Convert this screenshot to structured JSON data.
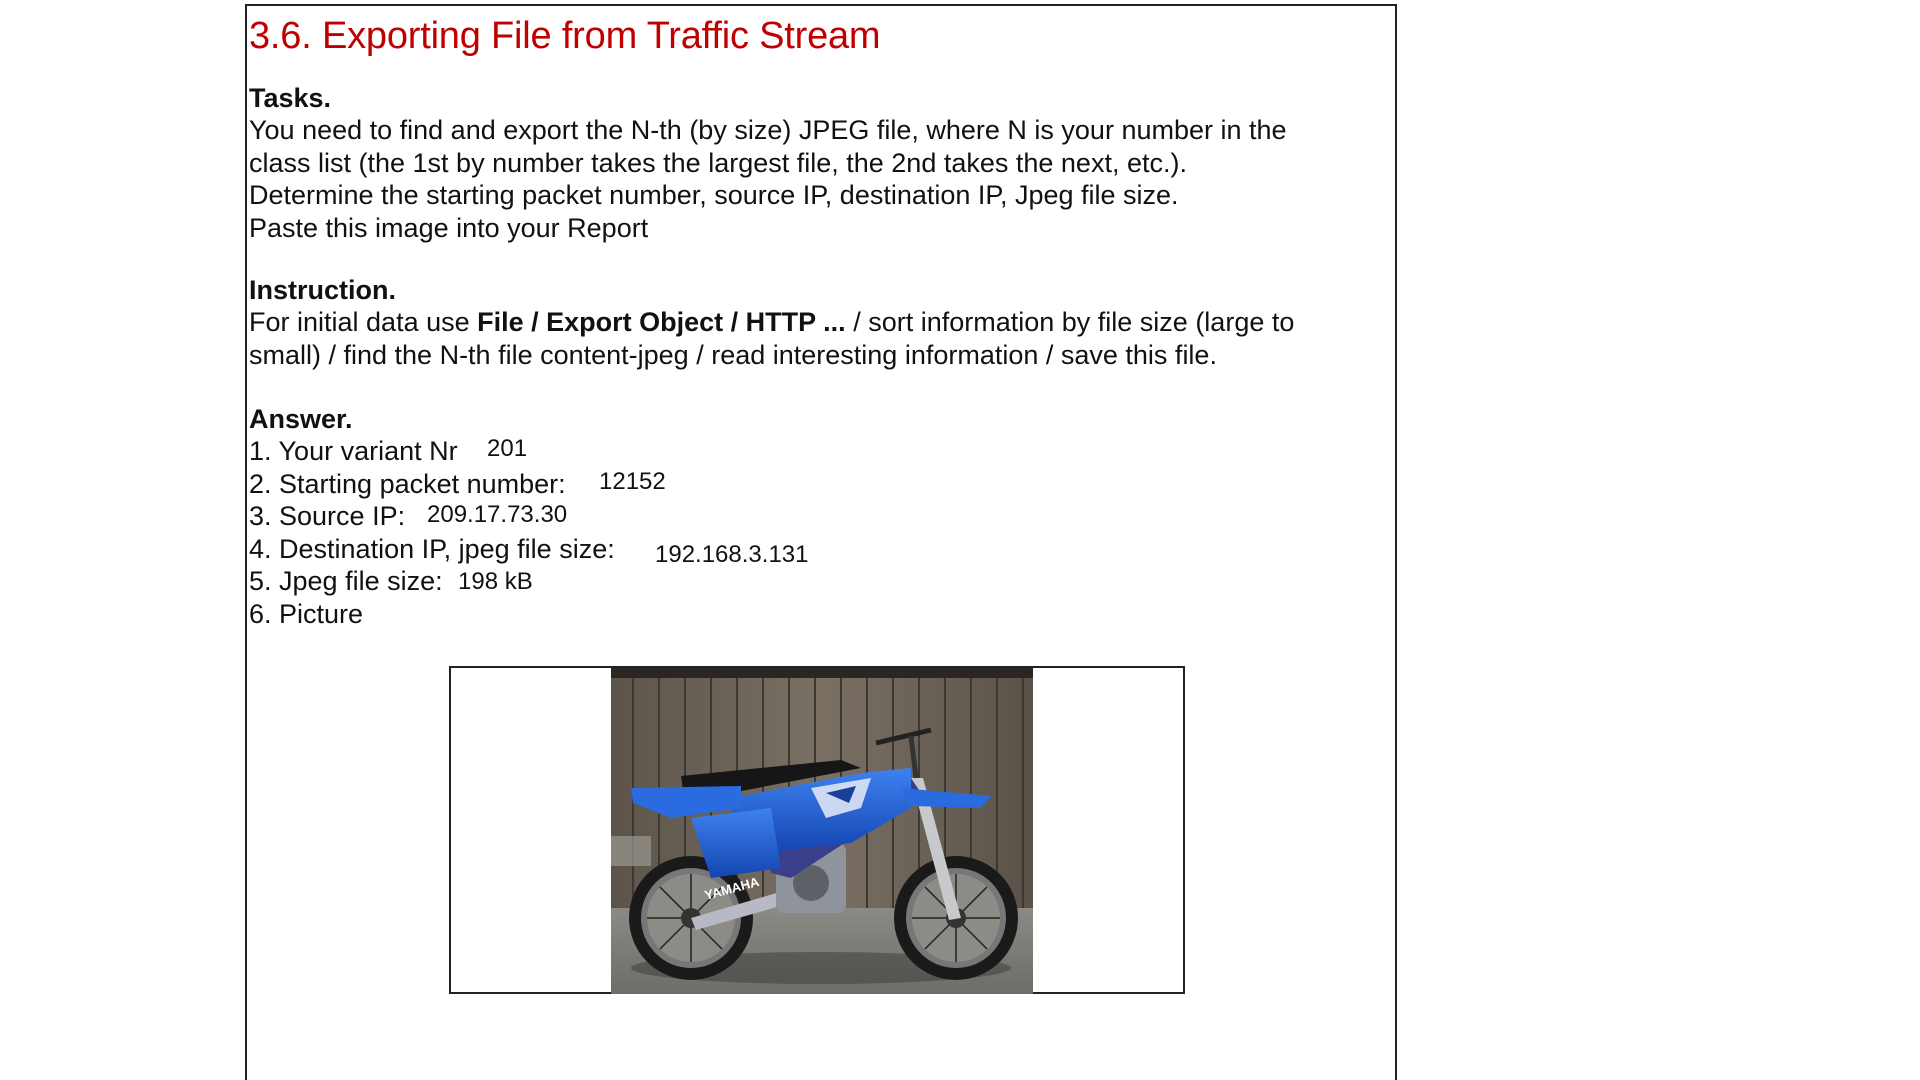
{
  "document": {
    "heading": "3.6. Exporting File from Traffic Stream",
    "tasks": {
      "title": "Tasks.",
      "lines": [
        "You need to find and export the N-th (by size) JPEG file, where N is your number in the",
        "class list (the 1st by number takes the largest file, the 2nd takes the next, etc.).",
        "Determine the starting packet number, source IP, destination IP, Jpeg file size.",
        "Paste this image into your Report"
      ]
    },
    "instruction": {
      "title": "Instruction.",
      "prefix": "For initial data use ",
      "bold_path": "File / Export Object / HTTP ...",
      "suffix_line1": " / sort information by file size (large to",
      "line2": "small) / find the N-th file content-jpeg / read interesting information / save this file."
    },
    "answer": {
      "title": "Answer.",
      "items": [
        {
          "label": "1. Your variant Nr",
          "value": "201"
        },
        {
          "label": "2. Starting packet number:",
          "value": "12152"
        },
        {
          "label": "3. Source IP:",
          "value": "209.17.73.30"
        },
        {
          "label": "4. Destination IP, jpeg file size:",
          "value": "192.168.3.131"
        },
        {
          "label": "5. Jpeg file size:",
          "value": "198 kB"
        },
        {
          "label": "6. Picture",
          "value": ""
        }
      ]
    },
    "picture": {
      "brand_text": "YAMAHA",
      "bike_color": "#1d5fd6",
      "fence_color": "#6f6559"
    }
  }
}
